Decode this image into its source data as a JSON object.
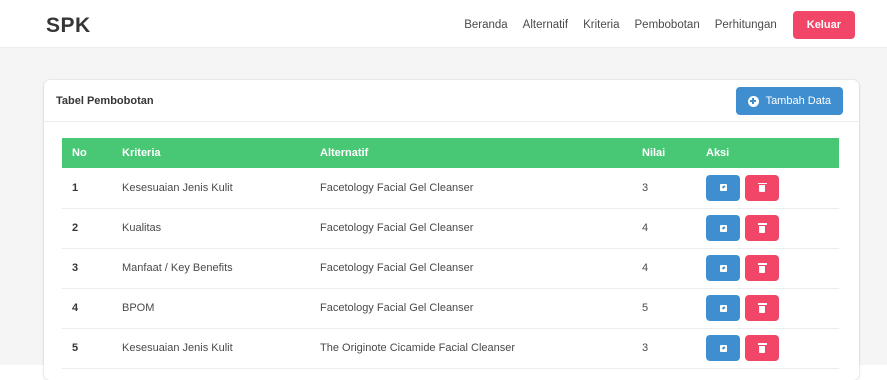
{
  "navbar": {
    "brand": "SPK",
    "links": [
      "Beranda",
      "Alternatif",
      "Kriteria",
      "Pembobotan",
      "Perhitungan"
    ],
    "logout_label": "Keluar"
  },
  "card": {
    "title": "Tabel Pembobotan",
    "add_label": "Tambah Data"
  },
  "table": {
    "headers": [
      "No",
      "Kriteria",
      "Alternatif",
      "Nilai",
      "Aksi"
    ],
    "rows": [
      {
        "no": "1",
        "kriteria": "Kesesuaian Jenis Kulit",
        "alternatif": "Facetology Facial Gel Cleanser",
        "nilai": "3"
      },
      {
        "no": "2",
        "kriteria": "Kualitas",
        "alternatif": "Facetology Facial Gel Cleanser",
        "nilai": "4"
      },
      {
        "no": "3",
        "kriteria": "Manfaat / Key Benefits",
        "alternatif": "Facetology Facial Gel Cleanser",
        "nilai": "4"
      },
      {
        "no": "4",
        "kriteria": "BPOM",
        "alternatif": "Facetology Facial Gel Cleanser",
        "nilai": "5"
      },
      {
        "no": "5",
        "kriteria": "Kesesuaian Jenis Kulit",
        "alternatif": "The Originote Cicamide Facial Cleanser",
        "nilai": "3"
      }
    ]
  },
  "icons": {
    "add": "plus-circle-icon",
    "edit": "edit-icon",
    "delete": "trash-icon"
  },
  "colors": {
    "header_green": "#48c774",
    "primary_blue": "#3e8ed0",
    "danger_red": "#f14668"
  }
}
